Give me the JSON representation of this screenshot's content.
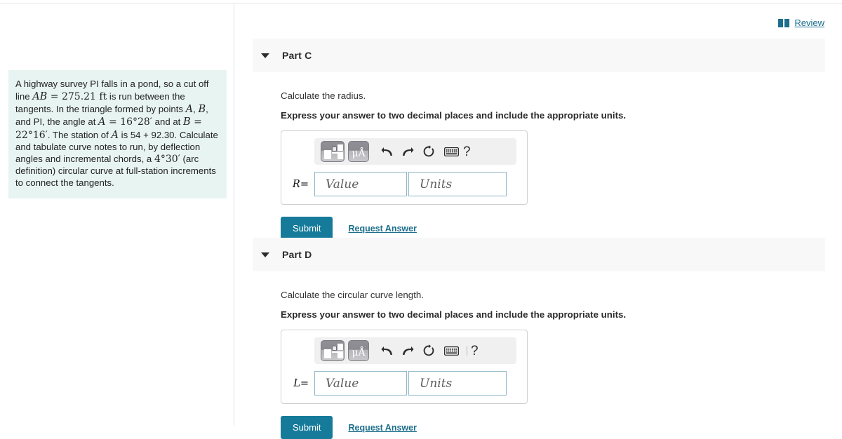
{
  "review": {
    "label": "Review",
    "icon": "book-icon",
    "color": "#1c6e8c"
  },
  "problem": {
    "segments": [
      {
        "t": "text",
        "v": "A highway survey PI falls in a pond, so a cut off line "
      },
      {
        "t": "mi",
        "v": "AB"
      },
      {
        "t": "mn",
        "v": " = 275.21 ft"
      },
      {
        "t": "text",
        "v": " is run between the tangents. In the triangle formed by points "
      },
      {
        "t": "mi",
        "v": "A"
      },
      {
        "t": "text",
        "v": ", "
      },
      {
        "t": "mi",
        "v": "B"
      },
      {
        "t": "text",
        "v": ", and PI, the angle at "
      },
      {
        "t": "mi",
        "v": "A"
      },
      {
        "t": "mn",
        "v": " = 16°28′"
      },
      {
        "t": "text",
        "v": " and at "
      },
      {
        "t": "mi",
        "v": "B"
      },
      {
        "t": "mn",
        "v": " = 22°16′"
      },
      {
        "t": "text",
        "v": ". The station of "
      },
      {
        "t": "mi",
        "v": "A"
      },
      {
        "t": "text",
        "v": " is 54 + 92.30. Calculate and tabulate curve notes to run, by deflection angles and incremental chords, a "
      },
      {
        "t": "mn",
        "v": "4°30′"
      },
      {
        "t": "text",
        "v": " (arc definition) circular curve at full-station increments to connect the tangents."
      }
    ],
    "background": "#e8f4f2"
  },
  "parts": [
    {
      "title": "Part C",
      "prompt": "Calculate the radius.",
      "instruction": "Express your answer to two decimal places and include the appropriate units.",
      "toolbar": {
        "template_button": "math-template-button",
        "unit_button_label": "μÅ",
        "undo": "undo-icon",
        "redo": "redo-icon",
        "reset": "reset-icon",
        "keyboard": "keyboard-icon",
        "help": "?",
        "separator": false
      },
      "variable": "R",
      "equals": "=",
      "value_placeholder": "Value",
      "units_placeholder": "Units",
      "value": "",
      "units": "",
      "submit_label": "Submit",
      "request_label": "Request Answer"
    },
    {
      "title": "Part D",
      "prompt": "Calculate the circular curve length.",
      "instruction": "Express your answer to two decimal places and include the appropriate units.",
      "toolbar": {
        "template_button": "math-template-button",
        "unit_button_label": "μÅ",
        "undo": "undo-icon",
        "redo": "redo-icon",
        "reset": "reset-icon",
        "keyboard": "keyboard-icon",
        "help": "?",
        "separator": true
      },
      "variable": "L",
      "equals": "=",
      "value_placeholder": "Value",
      "units_placeholder": "Units",
      "value": "",
      "units": "",
      "submit_label": "Submit",
      "request_label": "Request Answer"
    }
  ],
  "colors": {
    "accent": "#167b9b",
    "link": "#1c6e8c",
    "part_header_bg": "#f8f8f8",
    "problem_bg": "#e8f4f2",
    "input_border": "#8fb6c6"
  }
}
